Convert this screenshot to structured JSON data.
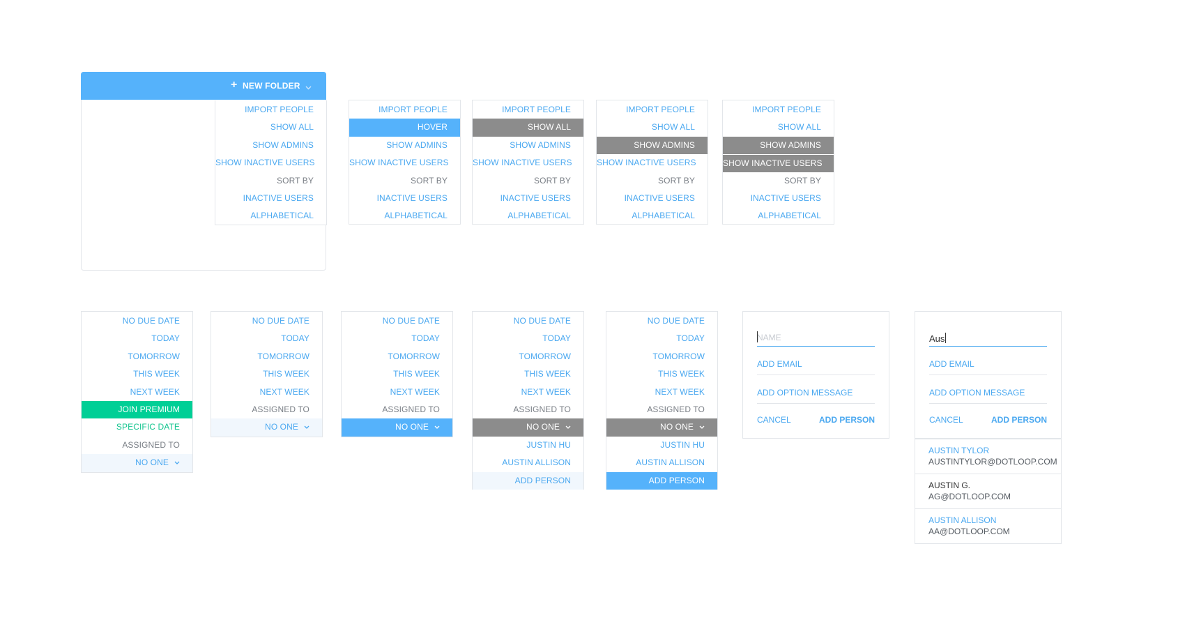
{
  "colors": {
    "accent": "#55b2fb",
    "link": "#4aa8f0",
    "selected_gray": "#8c8c8c",
    "premium_green": "#00cf96",
    "pale_highlight": "#f1f7fd"
  },
  "folder": {
    "new_folder_label": "NEW FOLDER",
    "plus_icon": "+",
    "menu": [
      "IMPORT PEOPLE",
      "SHOW ALL",
      "SHOW ADMINS",
      "SHOW INACTIVE USERS",
      "SORT BY",
      "INACTIVE USERS",
      "ALPHABETICAL"
    ]
  },
  "filter_menus": {
    "items": [
      "IMPORT PEOPLE",
      "SHOW ALL",
      "SHOW ADMINS",
      "SHOW INACTIVE USERS",
      "SORT BY",
      "INACTIVE USERS",
      "ALPHABETICAL"
    ],
    "hover_label": "HOVER"
  },
  "due_menus": {
    "items": [
      "NO DUE DATE",
      "TODAY",
      "TOMORROW",
      "THIS WEEK",
      "NEXT WEEK"
    ],
    "join_premium": "JOIN PREMIUM",
    "specific_date": "SPECIFIC DATE",
    "assigned_to": "ASSIGNED TO",
    "no_one": "NO ONE",
    "people": [
      "JUSTIN HU",
      "AUSTIN ALLISON"
    ],
    "add_person": "ADD PERSON"
  },
  "form_empty": {
    "name_placeholder": "NAME",
    "add_email": "ADD EMAIL",
    "add_option_message": "ADD OPTION MESSAGE",
    "cancel": "CANCEL",
    "add_person": "ADD PERSON"
  },
  "form_typed": {
    "name_value": "Aus",
    "add_email": "ADD EMAIL",
    "add_option_message": "ADD OPTION MESSAGE",
    "cancel": "CANCEL",
    "add_person": "ADD PERSON",
    "suggestions": [
      {
        "name": "AUSTIN TYLOR",
        "email": "AUSTINTYLOR@DOTLOOP.COM"
      },
      {
        "name": "AUSTIN G.",
        "email": "AG@DOTLOOP.COM"
      },
      {
        "name": "AUSTIN ALLISON",
        "email": "AA@DOTLOOP.COM"
      }
    ]
  }
}
